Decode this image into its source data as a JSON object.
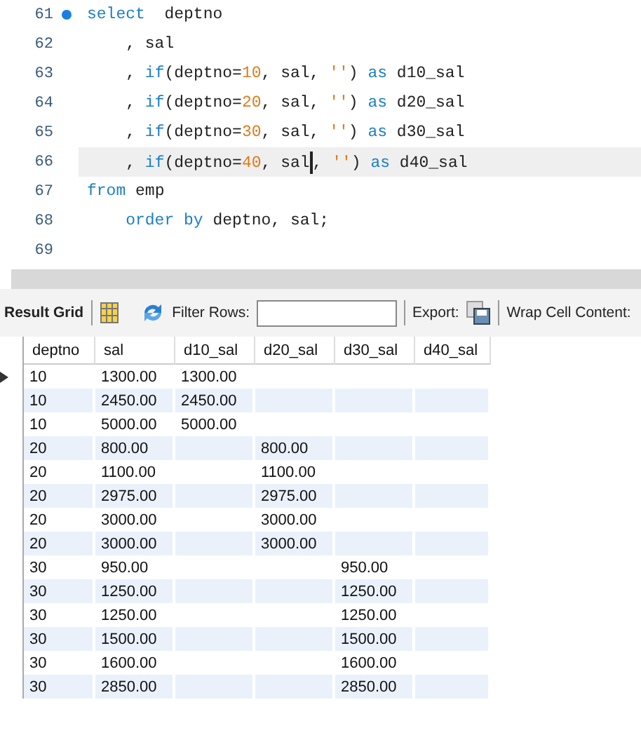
{
  "editor": {
    "lines": [
      {
        "number": "61",
        "marker": true,
        "current": false,
        "tokens": [
          {
            "kind": "kw",
            "text": "select"
          },
          {
            "kind": "plain",
            "text": "  deptno"
          }
        ]
      },
      {
        "number": "62",
        "marker": false,
        "current": false,
        "tokens": [
          {
            "kind": "plain",
            "text": "    , sal"
          }
        ]
      },
      {
        "number": "63",
        "marker": false,
        "current": false,
        "tokens": [
          {
            "kind": "plain",
            "text": "    , "
          },
          {
            "kind": "kw",
            "text": "if"
          },
          {
            "kind": "plain",
            "text": "(deptno="
          },
          {
            "kind": "num",
            "text": "10"
          },
          {
            "kind": "plain",
            "text": ", sal, "
          },
          {
            "kind": "str",
            "text": "''"
          },
          {
            "kind": "plain",
            "text": ") "
          },
          {
            "kind": "kw",
            "text": "as"
          },
          {
            "kind": "plain",
            "text": " d10_sal"
          }
        ]
      },
      {
        "number": "64",
        "marker": false,
        "current": false,
        "tokens": [
          {
            "kind": "plain",
            "text": "    , "
          },
          {
            "kind": "kw",
            "text": "if"
          },
          {
            "kind": "plain",
            "text": "(deptno="
          },
          {
            "kind": "num",
            "text": "20"
          },
          {
            "kind": "plain",
            "text": ", sal, "
          },
          {
            "kind": "str",
            "text": "''"
          },
          {
            "kind": "plain",
            "text": ") "
          },
          {
            "kind": "kw",
            "text": "as"
          },
          {
            "kind": "plain",
            "text": " d20_sal"
          }
        ]
      },
      {
        "number": "65",
        "marker": false,
        "current": false,
        "tokens": [
          {
            "kind": "plain",
            "text": "    , "
          },
          {
            "kind": "kw",
            "text": "if"
          },
          {
            "kind": "plain",
            "text": "(deptno="
          },
          {
            "kind": "num",
            "text": "30"
          },
          {
            "kind": "plain",
            "text": ", sal, "
          },
          {
            "kind": "str",
            "text": "''"
          },
          {
            "kind": "plain",
            "text": ") "
          },
          {
            "kind": "kw",
            "text": "as"
          },
          {
            "kind": "plain",
            "text": " d30_sal"
          }
        ]
      },
      {
        "number": "66",
        "marker": false,
        "current": true,
        "tokens": [
          {
            "kind": "plain",
            "text": "    , "
          },
          {
            "kind": "kw",
            "text": "if"
          },
          {
            "kind": "plain",
            "text": "(deptno="
          },
          {
            "kind": "num",
            "text": "40"
          },
          {
            "kind": "plain",
            "text": ", sal"
          },
          {
            "kind": "cursor"
          },
          {
            "kind": "plain",
            "text": ", "
          },
          {
            "kind": "str",
            "text": "''"
          },
          {
            "kind": "plain",
            "text": ") "
          },
          {
            "kind": "kw",
            "text": "as"
          },
          {
            "kind": "plain",
            "text": " d40_sal"
          }
        ]
      },
      {
        "number": "67",
        "marker": false,
        "current": false,
        "tokens": [
          {
            "kind": "kw",
            "text": "from"
          },
          {
            "kind": "plain",
            "text": " emp"
          }
        ]
      },
      {
        "number": "68",
        "marker": false,
        "current": false,
        "tokens": [
          {
            "kind": "kw",
            "text": "    order by"
          },
          {
            "kind": "plain",
            "text": " deptno, sal;"
          }
        ]
      },
      {
        "number": "69",
        "marker": false,
        "current": false
      }
    ]
  },
  "toolbar": {
    "title": "Result Grid",
    "filter_label": "Filter Rows:",
    "export_label": "Export:",
    "wrap_label": "Wrap Cell Content:"
  },
  "table": {
    "columns": [
      "deptno",
      "sal",
      "d10_sal",
      "d20_sal",
      "d30_sal",
      "d40_sal"
    ],
    "rows": [
      {
        "current": true,
        "cells": [
          "10",
          "1300.00",
          "1300.00",
          "",
          "",
          ""
        ]
      },
      {
        "current": false,
        "cells": [
          "10",
          "2450.00",
          "2450.00",
          "",
          "",
          ""
        ]
      },
      {
        "current": false,
        "cells": [
          "10",
          "5000.00",
          "5000.00",
          "",
          "",
          ""
        ]
      },
      {
        "current": false,
        "cells": [
          "20",
          "800.00",
          "",
          "800.00",
          "",
          ""
        ]
      },
      {
        "current": false,
        "cells": [
          "20",
          "1100.00",
          "",
          "1100.00",
          "",
          ""
        ]
      },
      {
        "current": false,
        "cells": [
          "20",
          "2975.00",
          "",
          "2975.00",
          "",
          ""
        ]
      },
      {
        "current": false,
        "cells": [
          "20",
          "3000.00",
          "",
          "3000.00",
          "",
          ""
        ]
      },
      {
        "current": false,
        "cells": [
          "20",
          "3000.00",
          "",
          "3000.00",
          "",
          ""
        ]
      },
      {
        "current": false,
        "cells": [
          "30",
          "950.00",
          "",
          "",
          "950.00",
          ""
        ]
      },
      {
        "current": false,
        "cells": [
          "30",
          "1250.00",
          "",
          "",
          "1250.00",
          ""
        ]
      },
      {
        "current": false,
        "cells": [
          "30",
          "1250.00",
          "",
          "",
          "1250.00",
          ""
        ]
      },
      {
        "current": false,
        "cells": [
          "30",
          "1500.00",
          "",
          "",
          "1500.00",
          ""
        ]
      },
      {
        "current": false,
        "cells": [
          "30",
          "1600.00",
          "",
          "",
          "1600.00",
          ""
        ]
      },
      {
        "current": false,
        "cells": [
          "30",
          "2850.00",
          "",
          "",
          "2850.00",
          ""
        ]
      }
    ]
  }
}
